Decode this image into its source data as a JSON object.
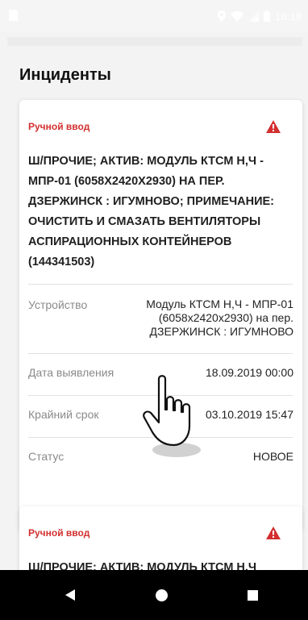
{
  "status_bar": {
    "time": "16:18",
    "icons": [
      "sd-card-icon",
      "location-icon",
      "wifi-icon",
      "signal-icon",
      "battery-icon"
    ]
  },
  "page": {
    "title": "Инциденты"
  },
  "incidents": [
    {
      "source": "Ручной ввод",
      "icon": "warning-icon",
      "description": "Ш/ПРОЧИЕ; АКТИВ: МОДУЛЬ КТСМ Н,Ч - МПР-01 (6058Х2420Х2930) НА ПЕР. ДЗЕРЖИНСК : ИГУМНОВО; ПРИМЕЧАНИЕ: ОЧИСТИТЬ И СМАЗАТЬ ВЕНТИЛЯТОРЫ АСПИРАЦИОННЫХ КОНТЕЙНЕРОВ (144341503)",
      "fields": {
        "device_label": "Устройство",
        "device_value": "Модуль КТСМ Н,Ч - МПР-01 (6058x2420x2930) на пер. ДЗЕРЖИНСК : ИГУМНОВО",
        "detected_label": "Дата выявления",
        "detected_value": "18.09.2019 00:00",
        "deadline_label": "Крайний срок",
        "deadline_value": "03.10.2019 15:47",
        "status_label": "Статус",
        "status_value": "НОВОЕ"
      }
    },
    {
      "source": "Ручной ввод",
      "icon": "warning-icon",
      "description": "Ш/ПРОЧИЕ; АКТИВ: МОДУЛЬ КТСМ Н,Ч"
    }
  ],
  "nav": {
    "icons": [
      "back-icon",
      "home-icon",
      "recents-icon"
    ]
  },
  "colors": {
    "accent": "#d32f2f",
    "background": "#f3f3f3",
    "card": "#ffffff",
    "label": "#8a8a8a"
  }
}
